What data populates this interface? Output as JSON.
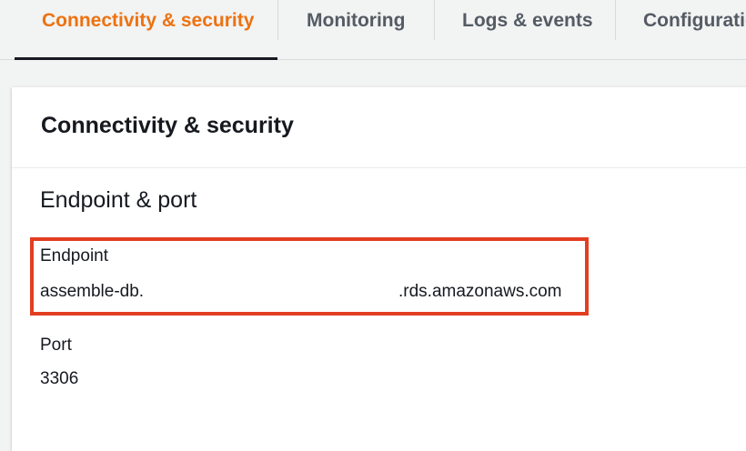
{
  "tabs": [
    {
      "label": "Connectivity & security",
      "active": true
    },
    {
      "label": "Monitoring",
      "active": false
    },
    {
      "label": "Logs & events",
      "active": false
    },
    {
      "label": "Configuratio",
      "active": false
    }
  ],
  "panel": {
    "title": "Connectivity & security",
    "section_title": "Endpoint & port",
    "endpoint": {
      "label": "Endpoint",
      "value_prefix": "assemble-db.",
      "value_suffix": ".rds.amazonaws.com"
    },
    "port": {
      "label": "Port",
      "value": "3306"
    }
  },
  "colors": {
    "tab_active": "#ec7211",
    "tab_inactive": "#545b64",
    "highlight_border": "#e23e22"
  }
}
